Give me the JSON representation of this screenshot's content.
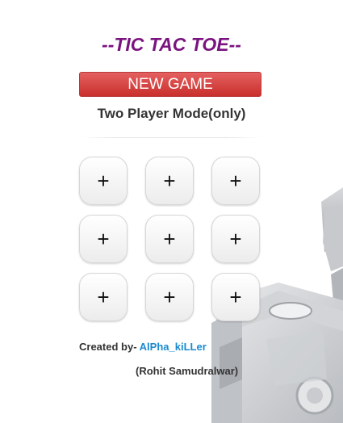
{
  "title": "--TIC TAC TOE--",
  "new_game_label": "NEW GAME",
  "mode_label": "Two Player Mode(only)",
  "board": {
    "cells": [
      "+",
      "+",
      "+",
      "+",
      "+",
      "+",
      "+",
      "+",
      "+"
    ]
  },
  "credit": {
    "prefix": "Created by-",
    "author": "AlPha_kiLLer",
    "real_name": "(Rohit Samudralwar)"
  },
  "colors": {
    "title": "#7a137f",
    "button": "#d9534f",
    "author_link": "#1a8ad0"
  }
}
